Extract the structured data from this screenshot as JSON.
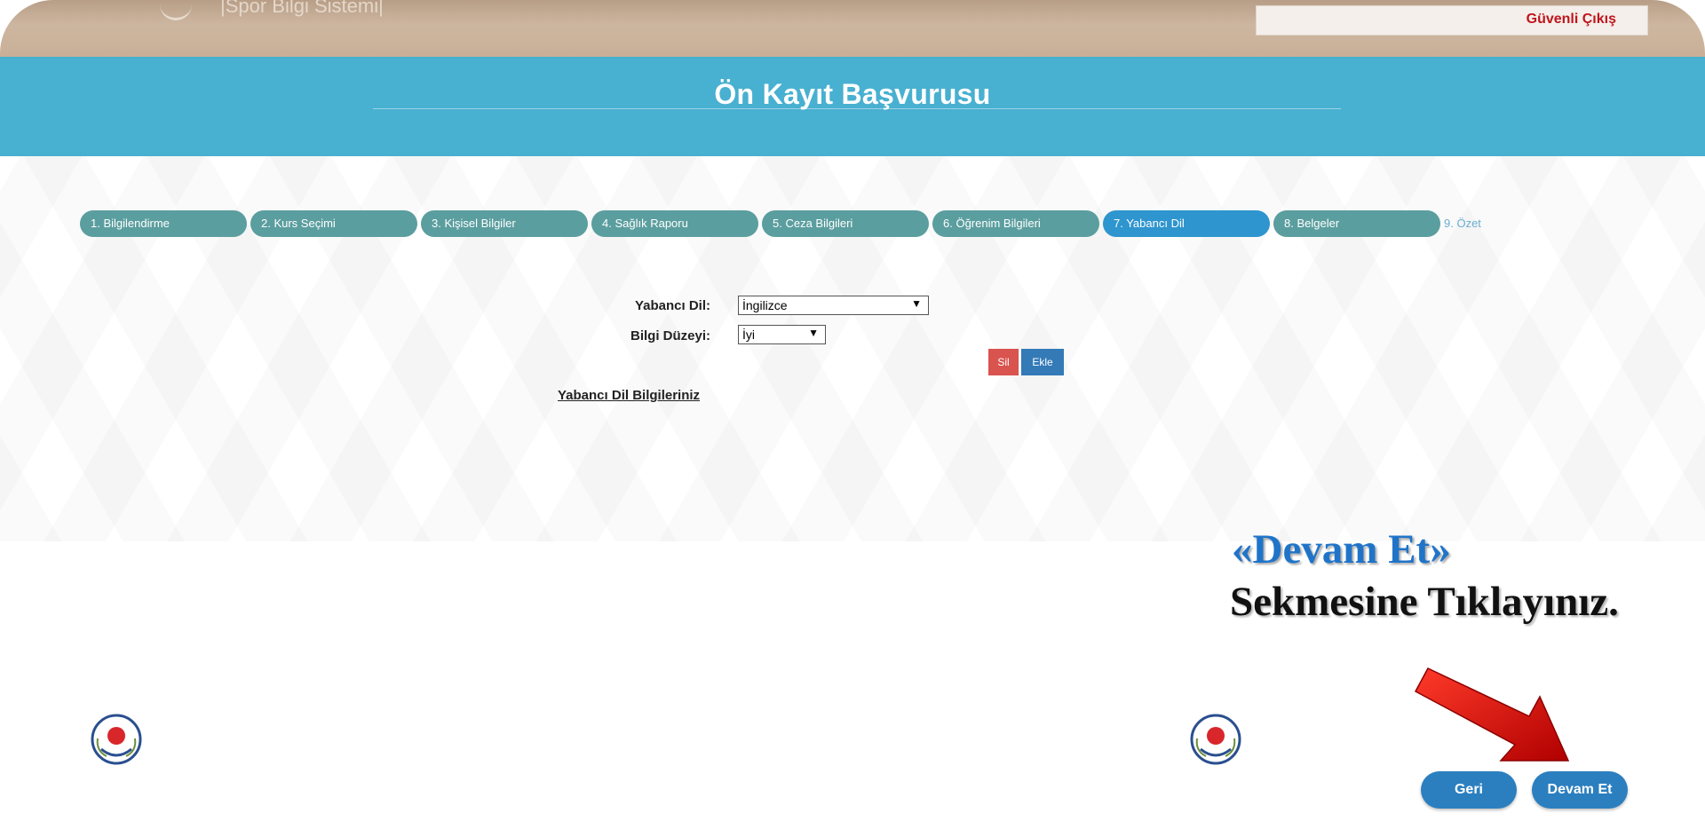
{
  "header": {
    "brand_text": "|Spor Bilgi Sistemi|",
    "logout_label": "Güvenli Çıkış"
  },
  "page_title": "Ön Kayıt Başvurusu",
  "steps": [
    {
      "label": "1. Bilgilendirme"
    },
    {
      "label": "2. Kurs Seçimi"
    },
    {
      "label": "3. Kişisel Bilgiler"
    },
    {
      "label": "4. Sağlık Raporu"
    },
    {
      "label": "5. Ceza Bilgileri"
    },
    {
      "label": "6. Öğrenim Bilgileri"
    },
    {
      "label": "7. Yabancı Dil"
    },
    {
      "label": "8. Belgeler"
    },
    {
      "label": "9. Özet"
    }
  ],
  "active_step": "7. Yabancı Dil",
  "form": {
    "language_label": "Yabancı Dil:",
    "language_value": "İngilizce",
    "level_label": "Bilgi Düzeyi:",
    "level_value": "İyi",
    "delete_label": "Sil",
    "add_label": "Ekle",
    "list_heading": "Yabancı Dil Bilgileriniz"
  },
  "annotation": {
    "line1": "«Devam Et»",
    "line2": "Sekmesine Tıklayınız."
  },
  "nav": {
    "back_label": "Geri",
    "continue_label": "Devam Et"
  },
  "colors": {
    "title_band": "#48b0d0",
    "step_inactive": "#5b9e9f",
    "step_active": "#2e95cf",
    "delete_button": "#d9534f",
    "add_button": "#337ab7",
    "nav_button": "#2b7fbf",
    "logout_text": "#c0141c",
    "annotation_blue": "#1f74c9",
    "arrow_red": "#e01010"
  },
  "icons": [
    "ministry-logo-icon",
    "dropdown-arrow-icon",
    "red-arrow-icon"
  ]
}
